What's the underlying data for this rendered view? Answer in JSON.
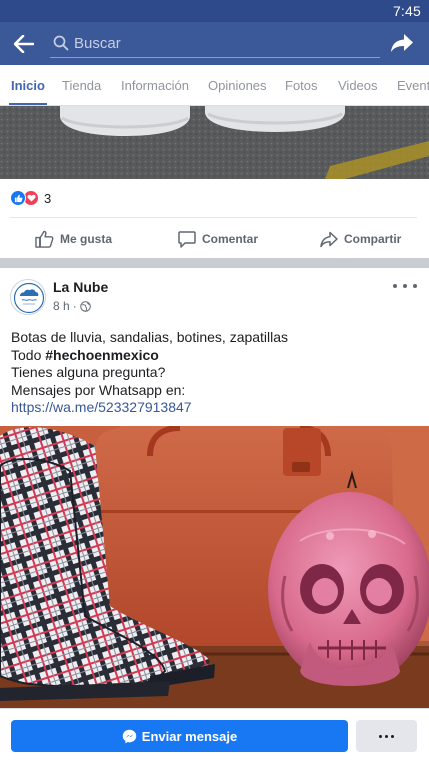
{
  "status_bar": {
    "time": "7:45"
  },
  "header": {
    "search_placeholder": "Buscar",
    "back_icon": "arrow-left-icon",
    "share_icon": "share-arrow-icon",
    "bg_color": "#3b5998"
  },
  "tabs": [
    {
      "label": "Inicio",
      "active": true
    },
    {
      "label": "Tienda"
    },
    {
      "label": "Información"
    },
    {
      "label": "Opiniones"
    },
    {
      "label": "Fotos"
    },
    {
      "label": "Videos"
    },
    {
      "label": "Eventos"
    }
  ],
  "previous_post": {
    "reaction_count": "3",
    "actions": {
      "like": "Me gusta",
      "comment": "Comentar",
      "share": "Compartir"
    }
  },
  "post": {
    "page_name": "La Nube",
    "time": "8 h",
    "audience_icon": "globe-icon",
    "text_line1": "Botas de lluvia, sandalias, botines, zapatillas",
    "text_line2_prefix": "Todo ",
    "hashtag": "#hechoenmexico",
    "text_line3": "Tienes alguna pregunta?",
    "text_line4": "Mensajes por Whatsapp en:",
    "link": "https://wa.me/523327913847"
  },
  "bottom_bar": {
    "send_message_label": "Enviar mensaje",
    "send_icon": "messenger-icon",
    "more_icon": "more-dots-icon",
    "accent_color": "#1877f2"
  }
}
